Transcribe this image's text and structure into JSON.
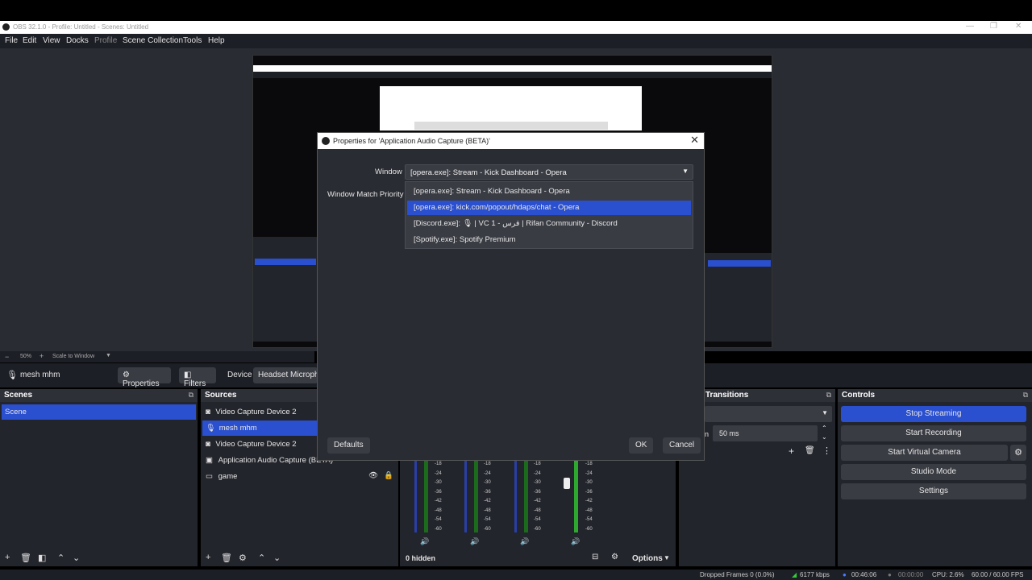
{
  "window": {
    "title": "OBS 32.1.0 - Profile: Untitled - Scenes: Untitled",
    "controls": [
      "—",
      "❐",
      "✕"
    ]
  },
  "menu": [
    "File",
    "Edit",
    "View",
    "Docks",
    "Profile",
    "Scene Collection",
    "Tools",
    "Help"
  ],
  "zoom": {
    "value": "50%",
    "mode": "Scale to Window"
  },
  "context": {
    "source": "mesh mhm",
    "properties": "Properties",
    "filters": "Filters",
    "device_label": "Device",
    "device_value": "Headset Micropho"
  },
  "scenes": {
    "title": "Scenes",
    "items": [
      "Scene"
    ]
  },
  "sources": {
    "title": "Sources",
    "items": [
      "Video Capture Device 2",
      "mesh mhm",
      "Video Capture Device 2",
      "Application Audio Capture (BETA)",
      "game"
    ]
  },
  "mixer": {
    "hidden": "0 hidden",
    "options": "Options",
    "scale": [
      "-18",
      "-24",
      "-30",
      "-36",
      "-42",
      "-48",
      "-54",
      "-60"
    ]
  },
  "transitions": {
    "title": "Transitions",
    "duration": "50 ms",
    "duration_label": "n"
  },
  "controls": {
    "title": "Controls",
    "stop_streaming": "Stop Streaming",
    "start_recording": "Start Recording",
    "start_virtual_camera": "Start Virtual Camera",
    "studio_mode": "Studio Mode",
    "settings": "Settings"
  },
  "status": {
    "dropped": "Dropped Frames 0 (0.0%)",
    "bitrate": "6177 kbps",
    "stream_time": "00:46:06",
    "rec_time": "00:00:00",
    "cpu": "CPU: 2.6%",
    "fps": "60.00 / 60.00 FPS"
  },
  "dialog": {
    "title": "Properties for 'Application Audio Capture (BETA)'",
    "window_label": "Window",
    "window_value": "[opera.exe]: Stream - Kick Dashboard - Opera",
    "priority_label": "Window Match Priority",
    "options": [
      "[opera.exe]: Stream - Kick Dashboard - Opera",
      "[opera.exe]: kick.com/popout/hdaps/chat - Opera",
      "[Discord.exe]: 🎙 | VC 1 - فرس | Rifan Community - Discord",
      "[Spotify.exe]: Spotify Premium"
    ],
    "selected_index": 1,
    "defaults": "Defaults",
    "ok": "OK",
    "cancel": "Cancel"
  },
  "colors": {
    "accent": "#2a4fcf",
    "panel": "#23252c",
    "background": "#2a2c33"
  }
}
